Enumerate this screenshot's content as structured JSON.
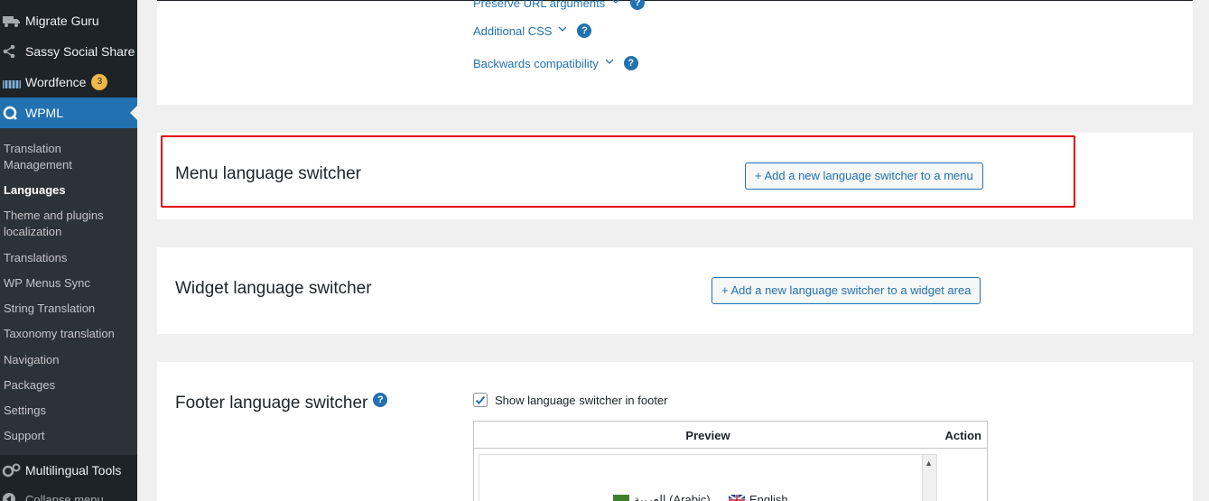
{
  "sidebar": {
    "top_items": [
      {
        "label": "Migrate Guru",
        "icon": "truck-icon"
      },
      {
        "label": "Sassy Social Share",
        "icon": "share-icon"
      },
      {
        "label": "Wordfence",
        "icon": "wordfence-icon",
        "badge": "3"
      },
      {
        "label": "WPML",
        "icon": "wpml-icon"
      }
    ],
    "submenu": [
      {
        "label": "Translation Management"
      },
      {
        "label": "Languages"
      },
      {
        "label": "Theme and plugins localization"
      },
      {
        "label": "Translations"
      },
      {
        "label": "WP Menus Sync"
      },
      {
        "label": "String Translation"
      },
      {
        "label": "Taxonomy translation"
      },
      {
        "label": "Navigation"
      },
      {
        "label": "Packages"
      },
      {
        "label": "Settings"
      },
      {
        "label": "Support"
      }
    ],
    "bottom_items": [
      {
        "label": "Multilingual Tools",
        "icon": "gears-icon"
      },
      {
        "label": "Collapse menu",
        "icon": "collapse-icon"
      }
    ]
  },
  "advanced": {
    "preserve_url": "Preserve URL arguments",
    "additional_css": "Additional CSS",
    "backwards_compat": "Backwards compatibility",
    "help": "?"
  },
  "menu_switcher": {
    "title": "Menu language switcher",
    "button": "+ Add a new language switcher to a menu"
  },
  "widget_switcher": {
    "title": "Widget language switcher",
    "button": "+ Add a new language switcher to a widget area"
  },
  "footer_switcher": {
    "title": "Footer language switcher",
    "help": "?",
    "checkbox_label": "Show language switcher in footer",
    "checkbox_checked": true,
    "table": {
      "col_preview": "Preview",
      "col_action": "Action"
    },
    "languages": [
      {
        "label": "العربية (Arabic)"
      },
      {
        "label": "English"
      }
    ]
  },
  "colors": {
    "accent": "#2271b1",
    "sidebar_bg": "#1d2327",
    "highlight": "#e60000",
    "badge": "#f0b849"
  }
}
